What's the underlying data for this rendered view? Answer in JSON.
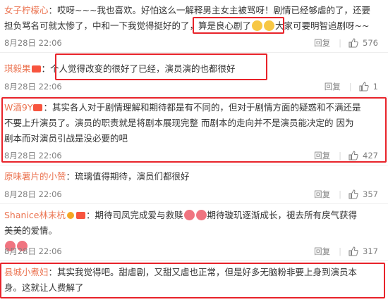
{
  "comments": [
    {
      "user": "女子柠檬心",
      "lines": [
        "哎呀~~~我也喜欢。好怕这么一解释男主女主被骂呀！剧情已经够虐的了，还要",
        "担负骂名可就太惨了，中和一下我觉得挺好的了，",
        "算是良心剧了",
        "大家可要明智追剧呀~~"
      ],
      "date": "8月28日 22:06",
      "reply": "回复",
      "likes": "576"
    },
    {
      "user": "琪毅果",
      "text": "个人觉得改变的很好了已经，演员演的也都很好",
      "date": "8月28日 22:06",
      "reply": "回复",
      "likes": "1"
    },
    {
      "user": "W酒9Y",
      "lines": [
        "其实各人对于剧情理解和期待都是有不同的，但对于剧情方面的疑惑和不满还是",
        "不要上升演员了。演员的职责就是将剧本展现完整    而剧本的走向并不是演员能决定的  因为",
        "剧本而对演员引战是没必要的吧"
      ],
      "date": "8月28日 22:06",
      "reply": "回复",
      "likes": "427"
    },
    {
      "user": "原味薯片的小赞",
      "text": "琉璃值得期待，演员们都很好",
      "date": "8月28日 22:06",
      "reply": "回复",
      "likes": "357"
    },
    {
      "user": "Shanice林末杭",
      "lines": [
        "期待司凤完成爱与救赎",
        "期待璇玑逐渐成长，褪去所有戾气获得",
        "美美的爱情。"
      ],
      "date": "8月28日 22:06",
      "reply": "回复",
      "likes": "317"
    },
    {
      "user": "县城小煮妇",
      "lines": [
        "其实我觉得吧。甜虐剧，又甜又虐也正常，但是好多无脑粉非要上身到演员本",
        "身。这就让人费解了"
      ]
    }
  ],
  "colors": {
    "username": "#eb7350",
    "highlight": "#e8232a",
    "meta": "#808080"
  },
  "icons": [
    "thumbs-up-icon",
    "verified-icon",
    "vip-icon",
    "emoji-icon"
  ]
}
